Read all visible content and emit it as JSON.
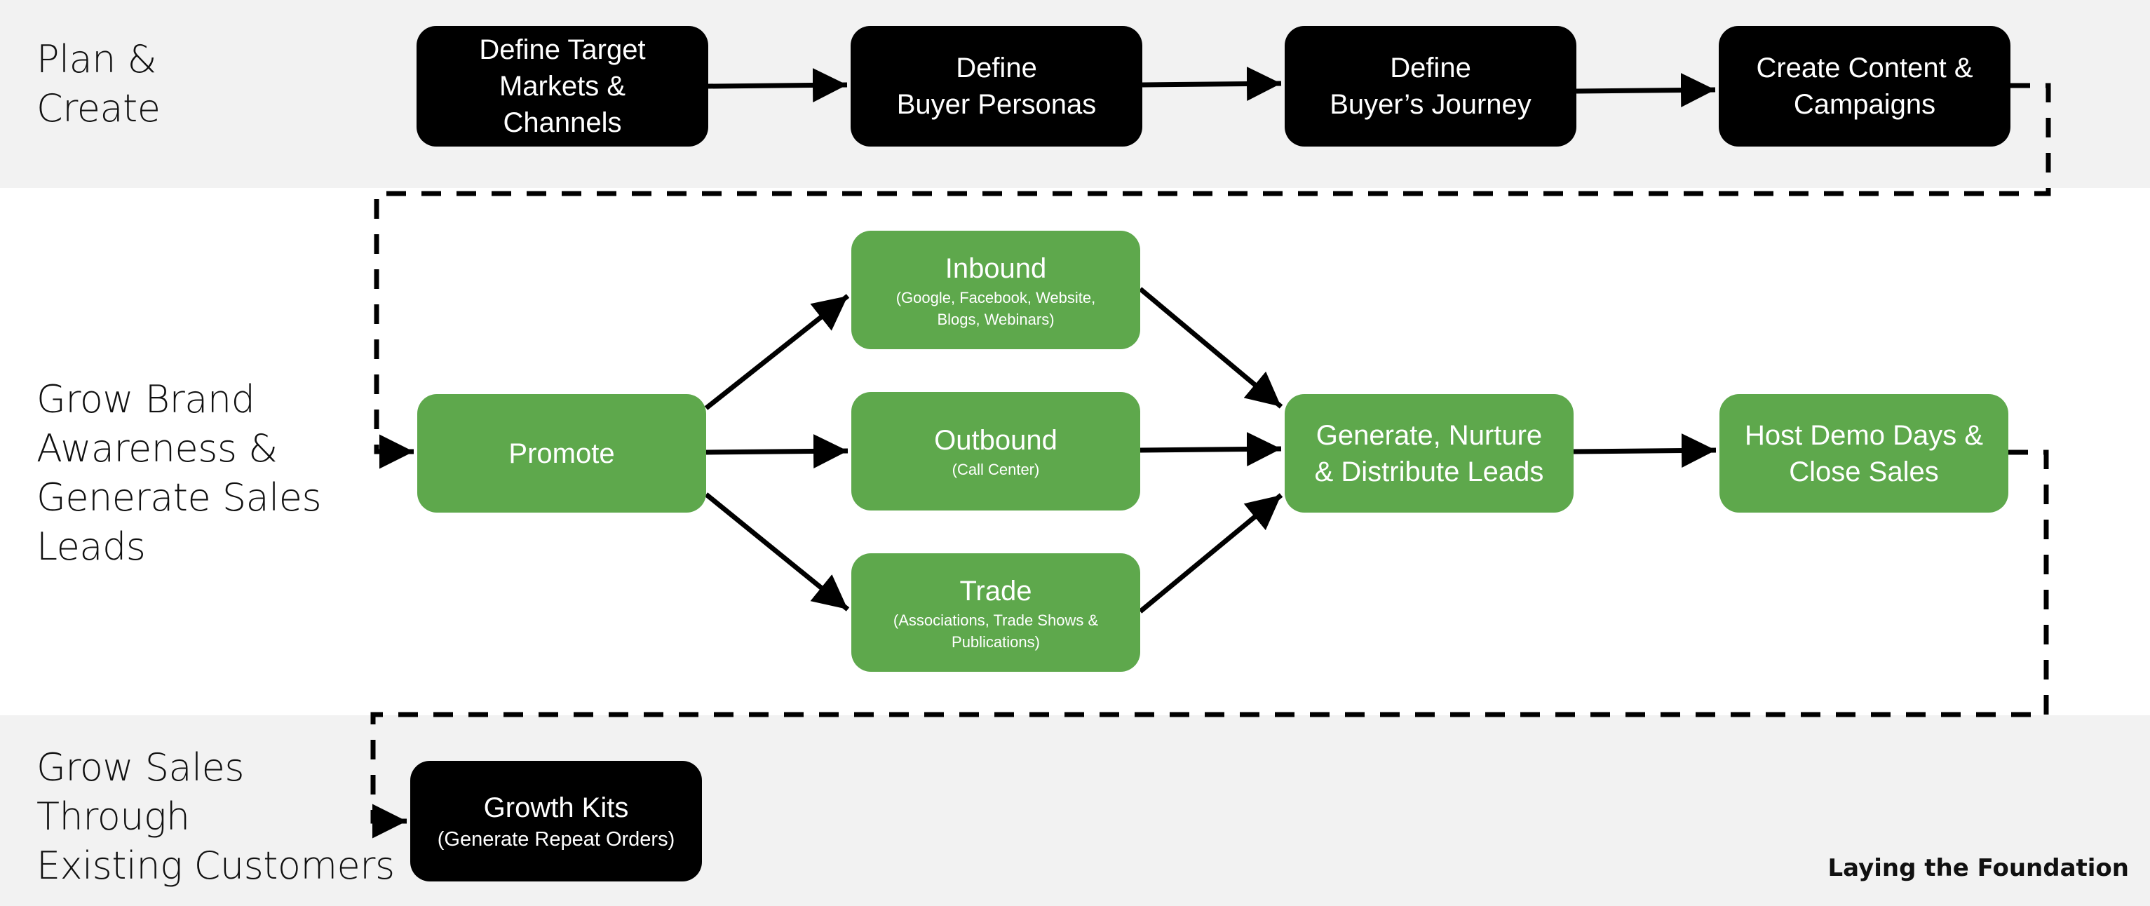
{
  "lanes": [
    {
      "label": "Plan &\nCreate"
    },
    {
      "label": "Grow Brand\nAwareness &\nGenerate Sales\nLeads"
    },
    {
      "label": "Grow Sales\nThrough\nExisting Customers"
    }
  ],
  "nodes": {
    "define_target_markets": {
      "title": "Define Target\nMarkets &\nChannels",
      "color": "black"
    },
    "define_buyer_personas": {
      "title": "Define\nBuyer Personas",
      "color": "black"
    },
    "define_buyers_journey": {
      "title": "Define\nBuyer’s Journey",
      "color": "black"
    },
    "create_content": {
      "title": "Create Content &\nCampaigns",
      "color": "black"
    },
    "promote": {
      "title": "Promote",
      "color": "green"
    },
    "inbound": {
      "title": "Inbound",
      "subtitle": "(Google, Facebook, Website,\nBlogs, Webinars)",
      "color": "green"
    },
    "outbound": {
      "title": "Outbound",
      "subtitle": "(Call Center)",
      "color": "green"
    },
    "trade": {
      "title": "Trade",
      "subtitle": "(Associations, Trade Shows &\nPublications)",
      "color": "green"
    },
    "generate_leads": {
      "title": "Generate, Nurture\n& Distribute Leads",
      "color": "green"
    },
    "host_demo_days": {
      "title": "Host Demo Days &\nClose Sales",
      "color": "green"
    },
    "growth_kits": {
      "title": "Growth Kits",
      "subtitle": "(Generate Repeat Orders)",
      "color": "black"
    }
  },
  "edges": [
    {
      "from": "define_target_markets",
      "to": "define_buyer_personas",
      "style": "solid"
    },
    {
      "from": "define_buyer_personas",
      "to": "define_buyers_journey",
      "style": "solid"
    },
    {
      "from": "define_buyers_journey",
      "to": "create_content",
      "style": "solid"
    },
    {
      "from": "create_content",
      "to": "promote",
      "style": "dashed"
    },
    {
      "from": "promote",
      "to": "inbound",
      "style": "solid"
    },
    {
      "from": "promote",
      "to": "outbound",
      "style": "solid"
    },
    {
      "from": "promote",
      "to": "trade",
      "style": "solid"
    },
    {
      "from": "inbound",
      "to": "generate_leads",
      "style": "solid"
    },
    {
      "from": "outbound",
      "to": "generate_leads",
      "style": "solid"
    },
    {
      "from": "trade",
      "to": "generate_leads",
      "style": "solid"
    },
    {
      "from": "generate_leads",
      "to": "host_demo_days",
      "style": "solid"
    },
    {
      "from": "host_demo_days",
      "to": "growth_kits",
      "style": "dashed"
    }
  ],
  "colors": {
    "green": "#5ea84c",
    "black": "#000000",
    "band": "#f2f2f2"
  },
  "footer": "Laying the Foundation"
}
